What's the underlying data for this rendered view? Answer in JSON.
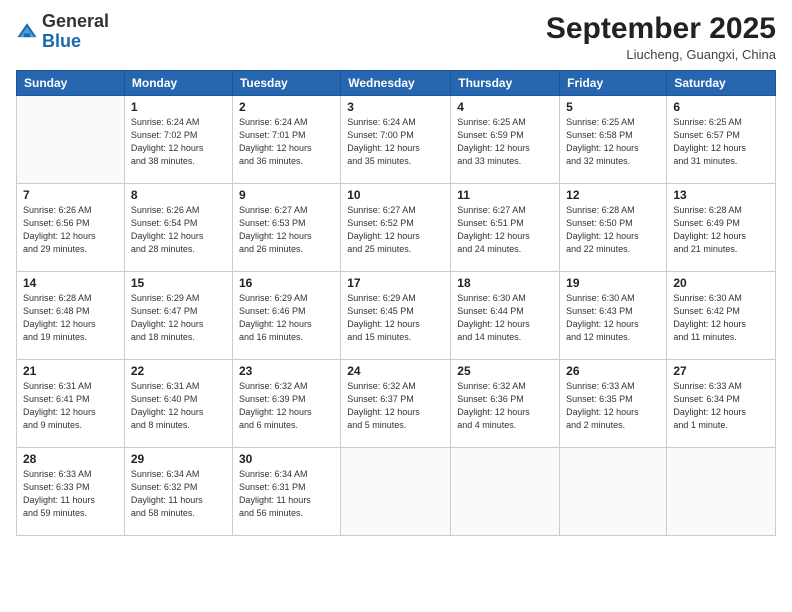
{
  "logo": {
    "general": "General",
    "blue": "Blue"
  },
  "header": {
    "month": "September 2025",
    "location": "Liucheng, Guangxi, China"
  },
  "weekdays": [
    "Sunday",
    "Monday",
    "Tuesday",
    "Wednesday",
    "Thursday",
    "Friday",
    "Saturday"
  ],
  "weeks": [
    [
      {
        "day": "",
        "info": ""
      },
      {
        "day": "1",
        "info": "Sunrise: 6:24 AM\nSunset: 7:02 PM\nDaylight: 12 hours\nand 38 minutes."
      },
      {
        "day": "2",
        "info": "Sunrise: 6:24 AM\nSunset: 7:01 PM\nDaylight: 12 hours\nand 36 minutes."
      },
      {
        "day": "3",
        "info": "Sunrise: 6:24 AM\nSunset: 7:00 PM\nDaylight: 12 hours\nand 35 minutes."
      },
      {
        "day": "4",
        "info": "Sunrise: 6:25 AM\nSunset: 6:59 PM\nDaylight: 12 hours\nand 33 minutes."
      },
      {
        "day": "5",
        "info": "Sunrise: 6:25 AM\nSunset: 6:58 PM\nDaylight: 12 hours\nand 32 minutes."
      },
      {
        "day": "6",
        "info": "Sunrise: 6:25 AM\nSunset: 6:57 PM\nDaylight: 12 hours\nand 31 minutes."
      }
    ],
    [
      {
        "day": "7",
        "info": "Sunrise: 6:26 AM\nSunset: 6:56 PM\nDaylight: 12 hours\nand 29 minutes."
      },
      {
        "day": "8",
        "info": "Sunrise: 6:26 AM\nSunset: 6:54 PM\nDaylight: 12 hours\nand 28 minutes."
      },
      {
        "day": "9",
        "info": "Sunrise: 6:27 AM\nSunset: 6:53 PM\nDaylight: 12 hours\nand 26 minutes."
      },
      {
        "day": "10",
        "info": "Sunrise: 6:27 AM\nSunset: 6:52 PM\nDaylight: 12 hours\nand 25 minutes."
      },
      {
        "day": "11",
        "info": "Sunrise: 6:27 AM\nSunset: 6:51 PM\nDaylight: 12 hours\nand 24 minutes."
      },
      {
        "day": "12",
        "info": "Sunrise: 6:28 AM\nSunset: 6:50 PM\nDaylight: 12 hours\nand 22 minutes."
      },
      {
        "day": "13",
        "info": "Sunrise: 6:28 AM\nSunset: 6:49 PM\nDaylight: 12 hours\nand 21 minutes."
      }
    ],
    [
      {
        "day": "14",
        "info": "Sunrise: 6:28 AM\nSunset: 6:48 PM\nDaylight: 12 hours\nand 19 minutes."
      },
      {
        "day": "15",
        "info": "Sunrise: 6:29 AM\nSunset: 6:47 PM\nDaylight: 12 hours\nand 18 minutes."
      },
      {
        "day": "16",
        "info": "Sunrise: 6:29 AM\nSunset: 6:46 PM\nDaylight: 12 hours\nand 16 minutes."
      },
      {
        "day": "17",
        "info": "Sunrise: 6:29 AM\nSunset: 6:45 PM\nDaylight: 12 hours\nand 15 minutes."
      },
      {
        "day": "18",
        "info": "Sunrise: 6:30 AM\nSunset: 6:44 PM\nDaylight: 12 hours\nand 14 minutes."
      },
      {
        "day": "19",
        "info": "Sunrise: 6:30 AM\nSunset: 6:43 PM\nDaylight: 12 hours\nand 12 minutes."
      },
      {
        "day": "20",
        "info": "Sunrise: 6:30 AM\nSunset: 6:42 PM\nDaylight: 12 hours\nand 11 minutes."
      }
    ],
    [
      {
        "day": "21",
        "info": "Sunrise: 6:31 AM\nSunset: 6:41 PM\nDaylight: 12 hours\nand 9 minutes."
      },
      {
        "day": "22",
        "info": "Sunrise: 6:31 AM\nSunset: 6:40 PM\nDaylight: 12 hours\nand 8 minutes."
      },
      {
        "day": "23",
        "info": "Sunrise: 6:32 AM\nSunset: 6:39 PM\nDaylight: 12 hours\nand 6 minutes."
      },
      {
        "day": "24",
        "info": "Sunrise: 6:32 AM\nSunset: 6:37 PM\nDaylight: 12 hours\nand 5 minutes."
      },
      {
        "day": "25",
        "info": "Sunrise: 6:32 AM\nSunset: 6:36 PM\nDaylight: 12 hours\nand 4 minutes."
      },
      {
        "day": "26",
        "info": "Sunrise: 6:33 AM\nSunset: 6:35 PM\nDaylight: 12 hours\nand 2 minutes."
      },
      {
        "day": "27",
        "info": "Sunrise: 6:33 AM\nSunset: 6:34 PM\nDaylight: 12 hours\nand 1 minute."
      }
    ],
    [
      {
        "day": "28",
        "info": "Sunrise: 6:33 AM\nSunset: 6:33 PM\nDaylight: 11 hours\nand 59 minutes."
      },
      {
        "day": "29",
        "info": "Sunrise: 6:34 AM\nSunset: 6:32 PM\nDaylight: 11 hours\nand 58 minutes."
      },
      {
        "day": "30",
        "info": "Sunrise: 6:34 AM\nSunset: 6:31 PM\nDaylight: 11 hours\nand 56 minutes."
      },
      {
        "day": "",
        "info": ""
      },
      {
        "day": "",
        "info": ""
      },
      {
        "day": "",
        "info": ""
      },
      {
        "day": "",
        "info": ""
      }
    ]
  ]
}
